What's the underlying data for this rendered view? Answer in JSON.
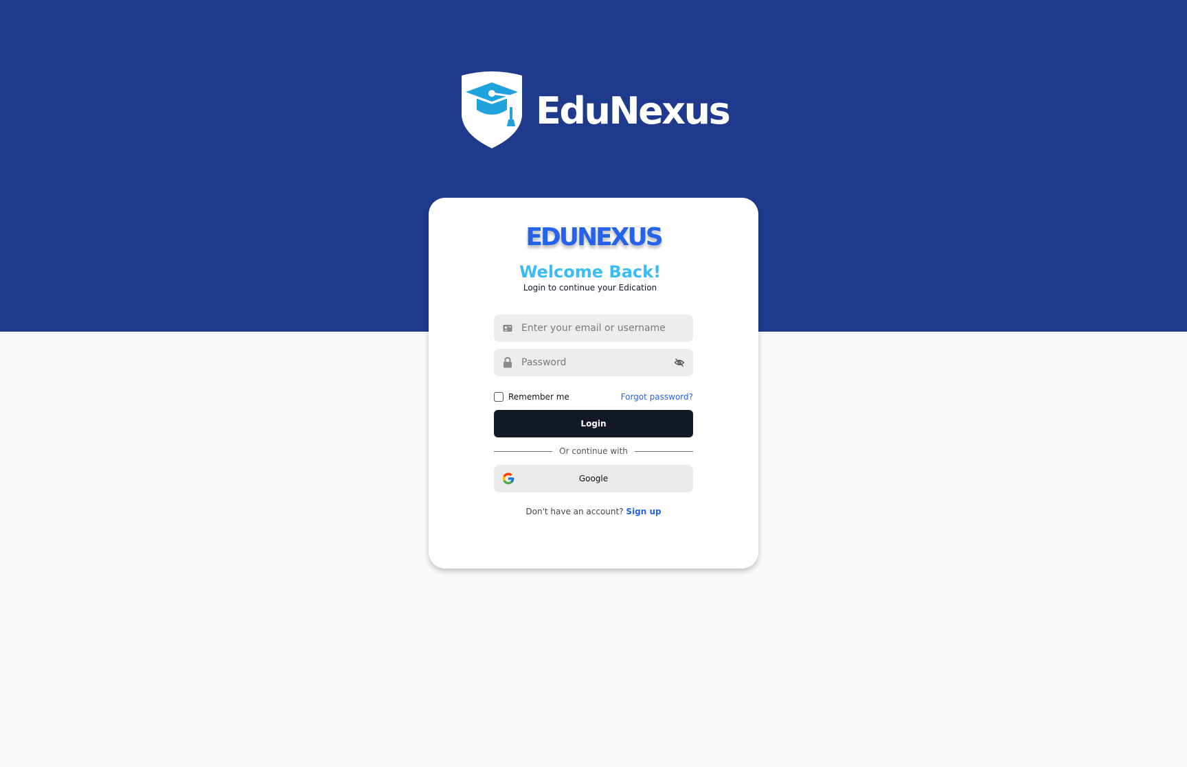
{
  "colors": {
    "header_band": "#1f3a8c",
    "page_background": "#f8f9fb",
    "card_background": "#ffffff",
    "wordmark": "#2563eb",
    "welcome": "#38bdf8",
    "login_button": "#121826",
    "link": "#2563eb",
    "input_background": "#ededed"
  },
  "header": {
    "brand_name": "EduNexus",
    "logo_icon": "graduation-cap-shield-icon"
  },
  "card": {
    "wordmark": "EDUNEXUS",
    "title": "Welcome Back!",
    "subtitle": "Login to continue your Edication"
  },
  "form": {
    "email": {
      "icon": "id-card-icon",
      "value": "",
      "placeholder": "Enter your email or username"
    },
    "password": {
      "icon": "lock-icon",
      "value": "",
      "placeholder": "Password",
      "toggle_icon": "eye-off-icon"
    },
    "remember_label": "Remember me",
    "remember_checked": false,
    "forgot_label": "Forgot password?",
    "login_label": "Login",
    "divider_label": "Or continue with",
    "google_label": "Google",
    "google_icon": "google-icon"
  },
  "footer": {
    "prompt": "Don't have an account?",
    "signup_label": "Sign up"
  }
}
